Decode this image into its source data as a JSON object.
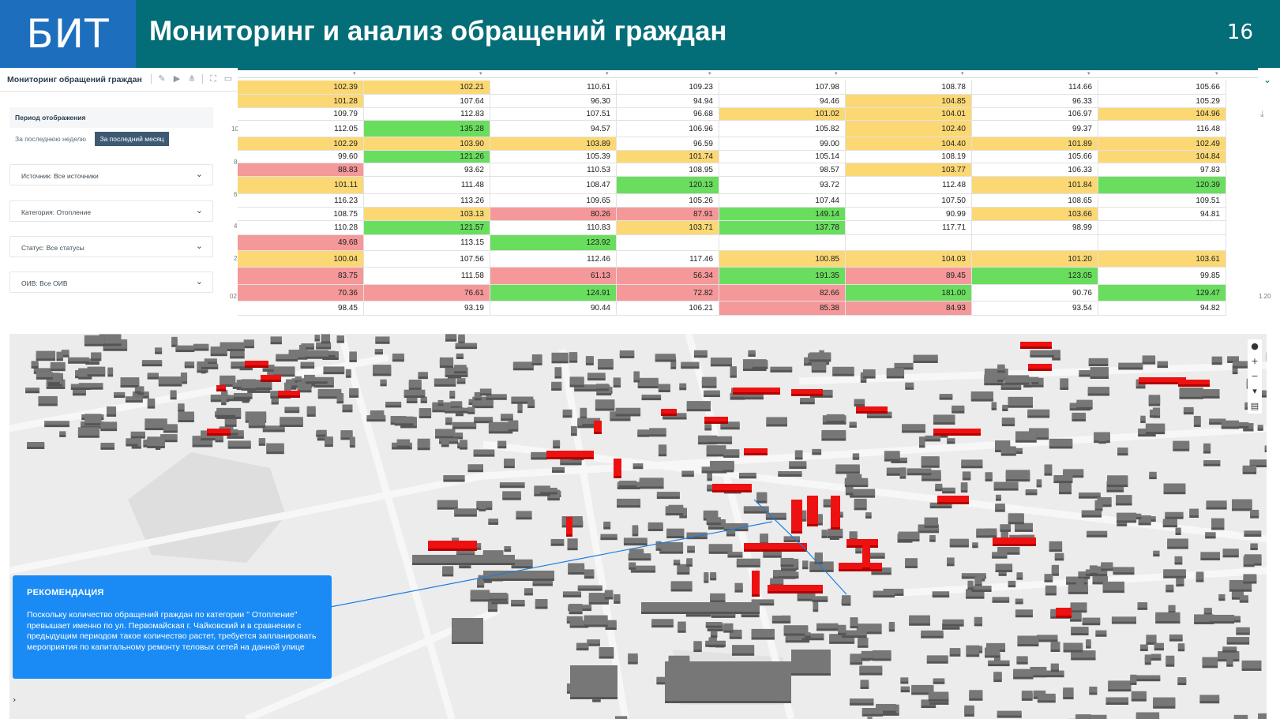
{
  "header": {
    "logo": "БИТ",
    "title": "Мониторинг и анализ обращений граждан",
    "page_number": "16"
  },
  "dashboard": {
    "title": "Мониторинг обращений граждан",
    "toolbar_icons": [
      "edit-icon",
      "play-icon",
      "hierarchy-icon",
      "fullscreen-icon",
      "present-icon"
    ],
    "period_label": "Период отображения",
    "period_buttons": {
      "week": "За последнюю неделю",
      "month": "За последний месяц"
    },
    "selected_period": "month",
    "filters": {
      "source": "Источник: Все источники",
      "category": "Категория: Отопление",
      "status": "Статус: Все статусы",
      "oiv": "ОИВ: Все ОИВ"
    },
    "axis_fragments": [
      "10",
      "8",
      "6",
      "4",
      "2",
      "02",
      "1.20"
    ],
    "colors": {
      "green": "#69dd5e",
      "yellow": "#fbd874",
      "red": "#f59899",
      "header": "#036e78",
      "logo": "#1d6fbd"
    },
    "table": {
      "rows": [
        [
          [
            "102.39",
            "y"
          ],
          [
            "102.21",
            "y"
          ],
          [
            "110.61",
            "w"
          ],
          [
            "109.23",
            "w"
          ],
          [
            "107.98",
            "w"
          ],
          [
            "108.78",
            "w"
          ],
          [
            "114.66",
            "w"
          ],
          [
            "105.66",
            "w"
          ]
        ],
        [
          [
            "101.28",
            "y"
          ],
          [
            "107.64",
            "w"
          ],
          [
            "96.30",
            "w"
          ],
          [
            "94.94",
            "w"
          ],
          [
            "94.46",
            "w"
          ],
          [
            "104.85",
            "y"
          ],
          [
            "96.33",
            "w"
          ],
          [
            "105.29",
            "w"
          ]
        ],
        [
          [
            "109.79",
            "w"
          ],
          [
            "112.83",
            "w"
          ],
          [
            "107.51",
            "w"
          ],
          [
            "96.68",
            "w"
          ],
          [
            "101.02",
            "y"
          ],
          [
            "104.01",
            "y"
          ],
          [
            "106.97",
            "w"
          ],
          [
            "104.96",
            "y"
          ]
        ],
        [
          [
            "112.05",
            "w"
          ],
          [
            "135.28",
            "g"
          ],
          [
            "94.57",
            "w"
          ],
          [
            "106.96",
            "w"
          ],
          [
            "105.82",
            "w"
          ],
          [
            "102.40",
            "y"
          ],
          [
            "99.37",
            "w"
          ],
          [
            "116.48",
            "w"
          ]
        ],
        [
          [
            "102.29",
            "y"
          ],
          [
            "103.90",
            "y"
          ],
          [
            "103.89",
            "y"
          ],
          [
            "96.59",
            "w"
          ],
          [
            "99.00",
            "w"
          ],
          [
            "104.40",
            "y"
          ],
          [
            "101.89",
            "y"
          ],
          [
            "102.49",
            "y"
          ]
        ],
        [
          [
            "99.60",
            "w"
          ],
          [
            "121.26",
            "g"
          ],
          [
            "105.39",
            "w"
          ],
          [
            "101.74",
            "y"
          ],
          [
            "105.14",
            "w"
          ],
          [
            "108.19",
            "w"
          ],
          [
            "105.66",
            "w"
          ],
          [
            "104.84",
            "y"
          ]
        ],
        [
          [
            "88.83",
            "r"
          ],
          [
            "93.62",
            "w"
          ],
          [
            "110.53",
            "w"
          ],
          [
            "108.95",
            "w"
          ],
          [
            "98.57",
            "w"
          ],
          [
            "103.77",
            "y"
          ],
          [
            "106.33",
            "w"
          ],
          [
            "97.83",
            "w"
          ]
        ],
        [
          [
            "101.11",
            "y"
          ],
          [
            "111.48",
            "w"
          ],
          [
            "108.47",
            "w"
          ],
          [
            "120.13",
            "g"
          ],
          [
            "93.72",
            "w"
          ],
          [
            "112.48",
            "w"
          ],
          [
            "101.84",
            "y"
          ],
          [
            "120.39",
            "g"
          ]
        ],
        [
          [
            "116.23",
            "w"
          ],
          [
            "113.26",
            "w"
          ],
          [
            "109.65",
            "w"
          ],
          [
            "105.26",
            "w"
          ],
          [
            "107.44",
            "w"
          ],
          [
            "107.50",
            "w"
          ],
          [
            "108.65",
            "w"
          ],
          [
            "109.51",
            "w"
          ]
        ],
        [
          [
            "108.75",
            "w"
          ],
          [
            "103.13",
            "y"
          ],
          [
            "80.26",
            "r"
          ],
          [
            "87.91",
            "r"
          ],
          [
            "149.14",
            "g"
          ],
          [
            "90.99",
            "w"
          ],
          [
            "103.66",
            "y"
          ],
          [
            "94.81",
            "w"
          ]
        ],
        [
          [
            "110.28",
            "w"
          ],
          [
            "121.57",
            "g"
          ],
          [
            "110.83",
            "w"
          ],
          [
            "103.71",
            "y"
          ],
          [
            "137.78",
            "g"
          ],
          [
            "117.71",
            "w"
          ],
          [
            "98.99",
            "w"
          ],
          [
            "",
            "w"
          ]
        ],
        [
          [
            "49.68",
            "r"
          ],
          [
            "113.15",
            "w"
          ],
          [
            "123.92",
            "g"
          ],
          [
            "",
            "w"
          ],
          [
            "",
            "w"
          ],
          [
            "",
            "w"
          ],
          [
            "",
            "w"
          ],
          [
            "",
            "w"
          ]
        ],
        [
          [
            "100.04",
            "y"
          ],
          [
            "107.56",
            "w"
          ],
          [
            "112.46",
            "w"
          ],
          [
            "117.46",
            "w"
          ],
          [
            "100.85",
            "y"
          ],
          [
            "104.03",
            "y"
          ],
          [
            "101.20",
            "y"
          ],
          [
            "103.61",
            "y"
          ]
        ],
        [
          [
            "83.75",
            "r"
          ],
          [
            "111.58",
            "w"
          ],
          [
            "61.13",
            "r"
          ],
          [
            "56.34",
            "r"
          ],
          [
            "191.35",
            "g"
          ],
          [
            "89.45",
            "r"
          ],
          [
            "123.05",
            "g"
          ],
          [
            "99.85",
            "w"
          ]
        ],
        [
          [
            "70.36",
            "r"
          ],
          [
            "76.61",
            "r"
          ],
          [
            "124.91",
            "g"
          ],
          [
            "72.82",
            "r"
          ],
          [
            "82.66",
            "r"
          ],
          [
            "181.00",
            "g"
          ],
          [
            "90.76",
            "w"
          ],
          [
            "129.47",
            "g"
          ]
        ],
        [
          [
            "98.45",
            "w"
          ],
          [
            "93.19",
            "w"
          ],
          [
            "90.44",
            "w"
          ],
          [
            "106.21",
            "w"
          ],
          [
            "85.38",
            "r"
          ],
          [
            "84.93",
            "r"
          ],
          [
            "93.54",
            "w"
          ],
          [
            "94.82",
            "w"
          ]
        ]
      ]
    }
  },
  "map": {
    "controls": [
      "comment-icon",
      "zoom-in-icon",
      "zoom-out-icon",
      "compass-icon",
      "layers-icon"
    ],
    "recommendation": {
      "title": "РЕКОМЕНДАЦИЯ",
      "text": "Поскольку количество обращений граждан по категории \" Отопление\" превышает именно по ул. Первомайская г. Чайковский и в сравнении с предыдущим периодом такое количество растет, требуется запланировать мероприятия по капитальному ремонту теловых сетей на данной улице"
    }
  }
}
